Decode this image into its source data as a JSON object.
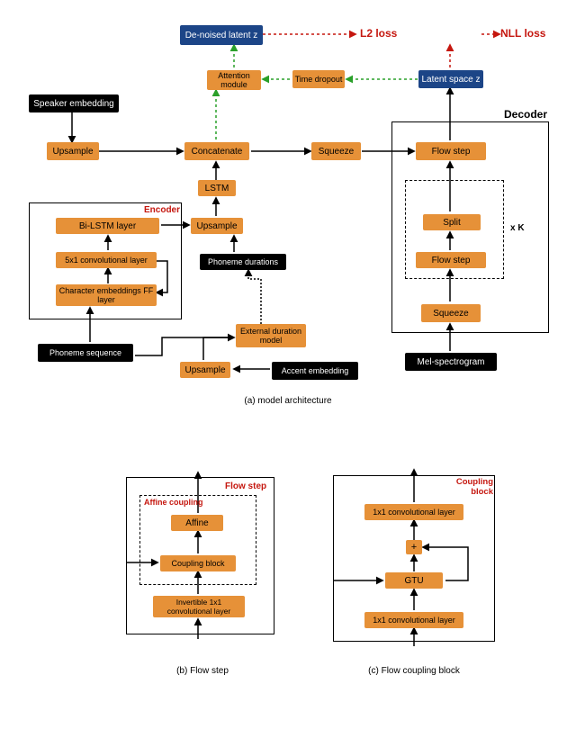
{
  "loss": {
    "l2": "L2 loss",
    "nll": "NLL loss"
  },
  "top": {
    "denoised": "De-noised latent z",
    "attention": "Attention module",
    "timedrop": "Time dropout",
    "latent": "Latent space z"
  },
  "left": {
    "speaker": "Speaker embedding",
    "upsample1": "Upsample",
    "concat": "Concatenate",
    "squeeze": "Squeeze",
    "lstm": "LSTM"
  },
  "encoder": {
    "title": "Encoder",
    "bilstm": "Bi-LSTM layer",
    "conv": "5x1 convolutional layer",
    "embed": "Character embeddings FF layer",
    "upsample": "Upsample",
    "phon_dur": "Phoneme durations",
    "ext_dur": "External duration model",
    "phon_seq": "Phoneme sequence",
    "upsample2": "Upsample",
    "accent": "Accent embedding"
  },
  "decoder": {
    "title": "Decoder",
    "flow1": "Flow step",
    "split": "Split",
    "flow2": "Flow step",
    "squeeze": "Squeeze",
    "xk": "x K",
    "mel": "Mel-spectrogram"
  },
  "captions": {
    "a": "(a) model architecture",
    "b": "(b) Flow step",
    "c": "(c) Flow coupling block"
  },
  "flowstep": {
    "title": "Flow step",
    "affine_title": "Affine coupling",
    "affine": "Affine",
    "coupling": "Coupling block",
    "inv": "Invertible 1x1 convolutional layer"
  },
  "coupling": {
    "title": "Coupling block",
    "conv_top": "1x1 convolutional layer",
    "plus": "+",
    "gtu": "GTU",
    "conv_bot": "1x1 convolutional layer"
  }
}
